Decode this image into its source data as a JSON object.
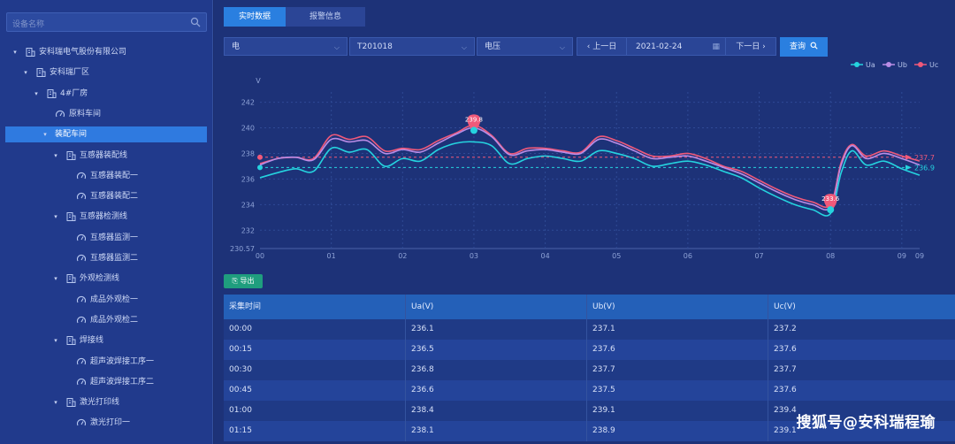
{
  "sidebar": {
    "search_placeholder": "设备名称",
    "tree": [
      {
        "label": "安科瑞电气股份有限公司",
        "icon": "building-icon",
        "caret": "▾"
      },
      {
        "label": "安科瑞厂区",
        "icon": "building-icon",
        "caret": "▾"
      },
      {
        "label": "4#厂房",
        "icon": "building-icon",
        "caret": "▾"
      },
      {
        "label": "原料车间",
        "icon": "meter-icon",
        "caret": ""
      },
      {
        "label": "装配车间",
        "icon": "",
        "caret": "▾",
        "active": true
      },
      {
        "label": "互感器装配线",
        "icon": "building-icon",
        "caret": "▾"
      },
      {
        "label": "互感器装配一",
        "icon": "meter-icon",
        "caret": ""
      },
      {
        "label": "互感器装配二",
        "icon": "meter-icon",
        "caret": ""
      },
      {
        "label": "互感器检测线",
        "icon": "building-icon",
        "caret": "▾"
      },
      {
        "label": "互感器监测一",
        "icon": "meter-icon",
        "caret": ""
      },
      {
        "label": "互感器监测二",
        "icon": "meter-icon",
        "caret": ""
      },
      {
        "label": "外观检测线",
        "icon": "building-icon",
        "caret": "▾"
      },
      {
        "label": "成品外观检一",
        "icon": "meter-icon",
        "caret": ""
      },
      {
        "label": "成品外观检二",
        "icon": "meter-icon",
        "caret": ""
      },
      {
        "label": "焊接线",
        "icon": "building-icon",
        "caret": "▾"
      },
      {
        "label": "超声波焊接工序一",
        "icon": "meter-icon",
        "caret": ""
      },
      {
        "label": "超声波焊接工序二",
        "icon": "meter-icon",
        "caret": ""
      },
      {
        "label": "激光打印线",
        "icon": "building-icon",
        "caret": "▾"
      },
      {
        "label": "激光打印一",
        "icon": "meter-icon",
        "caret": ""
      }
    ]
  },
  "tabs": {
    "realtime": "实时数据",
    "alarm": "报警信息"
  },
  "filters": {
    "energy": "电",
    "device": "T201018",
    "param": "电压"
  },
  "nav": {
    "prev": "上一日",
    "date": "2021-02-24",
    "next": "下一日",
    "query": "查询"
  },
  "export_label": "导出",
  "chart_data": {
    "type": "line",
    "ylabel": "V",
    "yticks": [
      "242",
      "240",
      "238",
      "236",
      "234",
      "232",
      "230.57"
    ],
    "xticks": [
      "00",
      "01",
      "02",
      "03",
      "04",
      "05",
      "06",
      "07",
      "08",
      "09",
      "09"
    ],
    "ylim": [
      230.57,
      242.8
    ],
    "grid": true,
    "legend": "top-right",
    "x": [
      0,
      0.25,
      0.5,
      0.75,
      1.0,
      1.25,
      1.5,
      1.75,
      2.0,
      2.25,
      2.5,
      2.75,
      3.0,
      3.25,
      3.5,
      3.75,
      4.0,
      4.25,
      4.5,
      4.75,
      5.0,
      5.25,
      5.5,
      5.75,
      6.0,
      6.25,
      6.5,
      6.75,
      7.0,
      7.25,
      7.5,
      7.75,
      8.0,
      8.15,
      8.3,
      8.5,
      8.75,
      9.0,
      9.25
    ],
    "series": [
      {
        "name": "Ua",
        "color": "#25d3df",
        "values": [
          236.1,
          236.5,
          236.8,
          236.6,
          238.4,
          238.1,
          238.3,
          237.0,
          237.6,
          237.4,
          238.3,
          238.8,
          238.9,
          238.6,
          237.2,
          237.6,
          237.8,
          237.6,
          237.4,
          238.2,
          238.0,
          237.6,
          237.0,
          237.2,
          237.4,
          237.1,
          236.6,
          236.1,
          235.3,
          234.6,
          234.0,
          233.6,
          233.3,
          236.5,
          238.2,
          237.1,
          237.4,
          236.8,
          236.3
        ]
      },
      {
        "name": "Ub",
        "color": "#b98ce6",
        "values": [
          237.1,
          237.6,
          237.7,
          237.5,
          239.1,
          238.9,
          239.0,
          238.0,
          238.3,
          238.1,
          238.8,
          239.5,
          240.0,
          239.3,
          237.9,
          238.2,
          238.3,
          238.1,
          238.0,
          239.1,
          238.8,
          238.2,
          237.6,
          237.7,
          237.8,
          237.4,
          236.9,
          236.4,
          235.7,
          235.0,
          234.4,
          234.0,
          233.8,
          237.1,
          238.6,
          237.6,
          238.0,
          237.6,
          237.1
        ]
      },
      {
        "name": "Uc",
        "color": "#f0597a",
        "values": [
          237.2,
          237.6,
          237.7,
          237.6,
          239.4,
          239.1,
          239.3,
          238.2,
          238.4,
          238.3,
          239.0,
          239.6,
          240.2,
          239.4,
          238.0,
          238.4,
          238.4,
          238.2,
          238.1,
          239.3,
          239.0,
          238.4,
          237.8,
          237.8,
          238.0,
          237.6,
          237.0,
          236.6,
          235.9,
          235.2,
          234.6,
          234.2,
          234.0,
          237.3,
          238.7,
          237.8,
          238.2,
          237.8,
          237.4
        ]
      }
    ],
    "max_marker": {
      "label": "239.8",
      "x": 3.0,
      "y": 239.8
    },
    "min_marker": {
      "label": "233.6",
      "x": 8.0,
      "y": 233.6
    },
    "avg_lines": [
      {
        "label": "237.7",
        "value": 237.7,
        "color": "#f0597a"
      },
      {
        "label": "236.9",
        "value": 236.9,
        "color": "#25d3df"
      }
    ]
  },
  "table": {
    "headers": [
      "采集时间",
      "Ua(V)",
      "Ub(V)",
      "Uc(V)"
    ],
    "rows": [
      [
        "00:00",
        "236.1",
        "237.1",
        "237.2"
      ],
      [
        "00:15",
        "236.5",
        "237.6",
        "237.6"
      ],
      [
        "00:30",
        "236.8",
        "237.7",
        "237.7"
      ],
      [
        "00:45",
        "236.6",
        "237.5",
        "237.6"
      ],
      [
        "01:00",
        "238.4",
        "239.1",
        "239.4"
      ],
      [
        "01:15",
        "238.1",
        "238.9",
        "239.1"
      ]
    ]
  },
  "watermark": "搜狐号@安科瑞程瑜"
}
